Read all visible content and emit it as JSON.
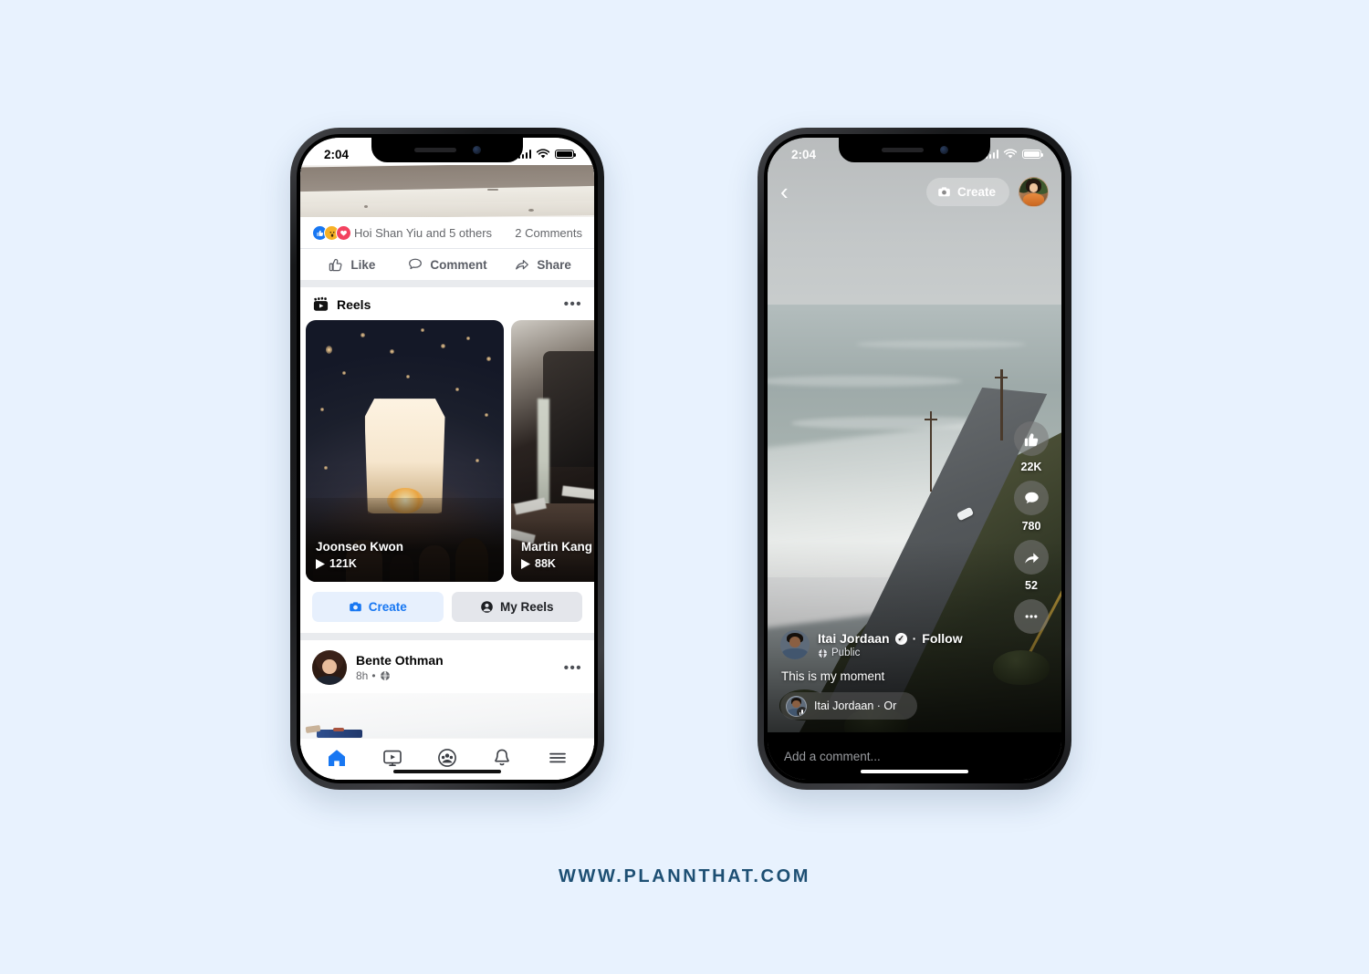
{
  "background_color": "#e8f2fe",
  "footer": {
    "url": "WWW.PLANNTHAT.COM",
    "color": "#1d4f73"
  },
  "left_phone": {
    "name": "facebook-feed-screen",
    "status_bar": {
      "time": "2:04",
      "signal": "signal-bars",
      "wifi": "wifi-icon",
      "battery": "battery-full"
    },
    "post_top": {
      "reactions": [
        "like",
        "wow",
        "love"
      ],
      "reaction_text": "Hoi Shan Yiu and 5 others",
      "comments_text": "2 Comments",
      "actions": [
        {
          "label": "Like",
          "icon": "thumbs-up-icon"
        },
        {
          "label": "Comment",
          "icon": "comment-bubble-icon"
        },
        {
          "label": "Share",
          "icon": "share-arrow-icon"
        }
      ]
    },
    "reels": {
      "title": "Reels",
      "icon": "reels-clapper-icon",
      "overflow": "•••",
      "cards": [
        {
          "name": "Joonseo Kwon",
          "views": "121K",
          "scene": "sky-lantern-festival"
        },
        {
          "name": "Martin Kang",
          "views": "88K",
          "scene": "coffee-machine"
        }
      ],
      "buttons": [
        {
          "label": "Create",
          "icon": "camera-icon",
          "color": "#1877f2"
        },
        {
          "label": "My Reels",
          "icon": "person-circle-icon",
          "color": "#1d1f23"
        }
      ]
    },
    "post_bottom": {
      "author": "Bente Othman",
      "time": "8h",
      "separator": "•",
      "privacy_icon": "globe-icon",
      "overflow": "•••"
    },
    "tabbar": [
      {
        "name": "home",
        "icon": "home-icon",
        "active": true
      },
      {
        "name": "watch",
        "icon": "video-screen-icon",
        "active": false
      },
      {
        "name": "groups",
        "icon": "groups-icon",
        "active": false
      },
      {
        "name": "notifications",
        "icon": "bell-icon",
        "active": false
      },
      {
        "name": "menu",
        "icon": "hamburger-menu-icon",
        "active": false
      }
    ],
    "accent_color": "#1877f2"
  },
  "right_phone": {
    "name": "facebook-reel-player-screen",
    "status_bar": {
      "time": "2:04",
      "signal": "signal-bars",
      "wifi": "wifi-icon",
      "battery": "battery-full"
    },
    "top": {
      "back_icon": "chevron-left-icon",
      "create_label": "Create",
      "create_icon": "camera-icon",
      "avatar": "user-avatar"
    },
    "video_scene": "coastal-highway-ocean",
    "rail": [
      {
        "name": "like",
        "icon": "thumbs-up-icon",
        "count": "22K"
      },
      {
        "name": "comment",
        "icon": "comment-bubble-icon",
        "count": "780"
      },
      {
        "name": "share",
        "icon": "share-arrow-icon",
        "count": "52"
      },
      {
        "name": "more",
        "icon": "ellipsis-icon",
        "count": ""
      }
    ],
    "author": {
      "name": "Itai Jordaan",
      "verified_glyph": "✓",
      "separator": "·",
      "follow_label": "Follow",
      "privacy": "Public",
      "privacy_icon": "globe-icon"
    },
    "caption": "This is my moment",
    "audio": {
      "text": "Itai Jordaan · Or",
      "icon": "audio-waveform-icon"
    },
    "comment_placeholder": "Add a comment..."
  }
}
